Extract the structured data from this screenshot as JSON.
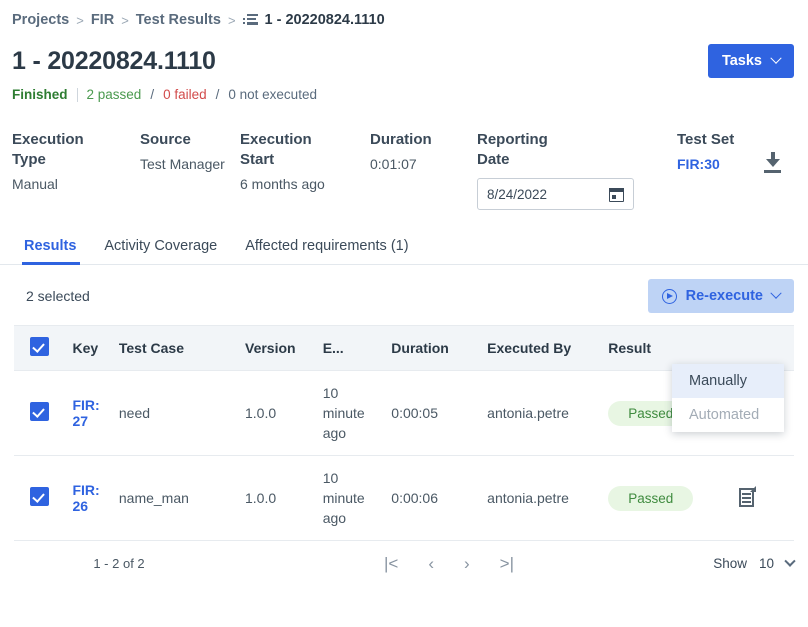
{
  "breadcrumb": {
    "items": [
      "Projects",
      "FIR",
      "Test Results"
    ],
    "separator": ">",
    "current": "1 - 20220824.1110",
    "current_icon": "test-results-icon"
  },
  "header": {
    "title": "1 - 20220824.1110",
    "tasks_button": "Tasks",
    "tasks_chevron_icon": "chevron-down-icon"
  },
  "status": {
    "state": "Finished",
    "passed": "2 passed",
    "sep1": "/",
    "failed": "0 failed",
    "sep2": "/",
    "not_executed": "0 not executed"
  },
  "meta": {
    "execution_type": {
      "label": "Execution Type",
      "value": "Manual"
    },
    "source": {
      "label": "Source",
      "value": "Test Manager"
    },
    "execution_start": {
      "label": "Execution Start",
      "value": "6 months ago"
    },
    "duration": {
      "label": "Duration",
      "value": "0:01:07"
    },
    "reporting_date": {
      "label": "Reporting Date",
      "value": "8/24/2022",
      "icon": "calendar-icon"
    },
    "test_set": {
      "label": "Test Set",
      "value": "FIR:30"
    },
    "download_icon": "download-icon"
  },
  "tabs": [
    {
      "label": "Results",
      "active": true
    },
    {
      "label": "Activity Coverage",
      "active": false
    },
    {
      "label": "Affected requirements (1)",
      "active": false
    }
  ],
  "toolbar": {
    "selected_count": "2 selected",
    "reexecute_label": "Re-execute",
    "reexecute_play_icon": "play-circle-icon",
    "reexecute_chevron_icon": "chevron-down-icon"
  },
  "dropdown": {
    "items": [
      {
        "label": "Manually",
        "state": "hover"
      },
      {
        "label": "Automated",
        "state": "disabled"
      }
    ]
  },
  "table": {
    "select_all_checked": true,
    "columns": [
      "Key",
      "Test Case",
      "Version",
      "E...",
      "Duration",
      "Executed By",
      "Result"
    ],
    "rows": [
      {
        "checked": true,
        "key": "FIR:27",
        "test_case": "need",
        "version": "1.0.0",
        "executed": "10 minute ago",
        "duration": "0:00:05",
        "executed_by": "antonia.petre",
        "result": "Passed",
        "action_icon": "document-report-icon"
      },
      {
        "checked": true,
        "key": "FIR:26",
        "test_case": "name_man",
        "version": "1.0.0",
        "executed": "10 minute ago",
        "duration": "0:00:06",
        "executed_by": "antonia.petre",
        "result": "Passed",
        "action_icon": "document-report-icon"
      }
    ]
  },
  "footer": {
    "range": "1 - 2 of 2",
    "first_icon": "|<",
    "prev_icon": "‹",
    "next_icon": "›",
    "last_icon": ">|",
    "show_label": "Show",
    "page_size": "10",
    "page_size_chevron_icon": "chevron-down-icon"
  },
  "colors": {
    "primary": "#2f63e0",
    "primary_soft": "#bed3f5",
    "pass_text": "#3f8b3f",
    "pass_bg": "#e8f6e3",
    "fail_text": "#d24b4b",
    "finished": "#2e7d32",
    "table_header_bg": "#f2f5f8"
  }
}
